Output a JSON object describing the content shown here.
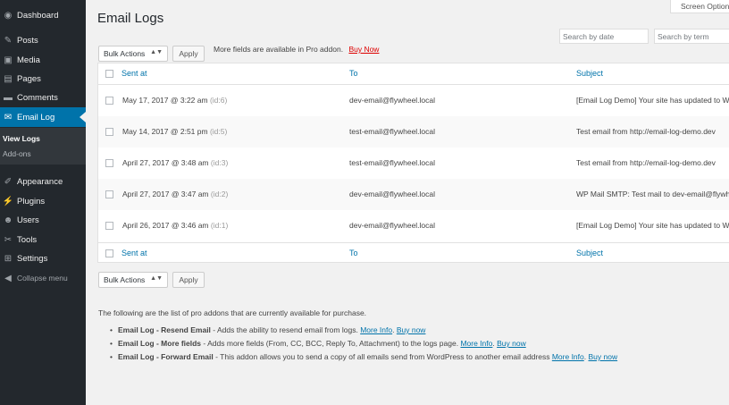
{
  "sidebar": {
    "items": [
      {
        "label": "Dashboard",
        "icon": "dashboard-icon",
        "glyph": "◉"
      },
      {
        "label": "Posts",
        "icon": "pin-icon",
        "glyph": "✎"
      },
      {
        "label": "Media",
        "icon": "media-icon",
        "glyph": "▣"
      },
      {
        "label": "Pages",
        "icon": "pages-icon",
        "glyph": "▤"
      },
      {
        "label": "Comments",
        "icon": "comment-icon",
        "glyph": "▬"
      },
      {
        "label": "Email Log",
        "icon": "email-icon",
        "glyph": "✉"
      },
      {
        "label": "Appearance",
        "icon": "brush-icon",
        "glyph": "✐"
      },
      {
        "label": "Plugins",
        "icon": "plugin-icon",
        "glyph": "⚡"
      },
      {
        "label": "Users",
        "icon": "users-icon",
        "glyph": "☻"
      },
      {
        "label": "Tools",
        "icon": "wrench-icon",
        "glyph": "✂"
      },
      {
        "label": "Settings",
        "icon": "settings-icon",
        "glyph": "⊞"
      }
    ],
    "submenu": [
      "View Logs",
      "Add-ons"
    ],
    "collapse_label": "Collapse menu",
    "collapse_glyph": "◀"
  },
  "header": {
    "title": "Email Logs",
    "screen_options": "Screen Options"
  },
  "search": {
    "by_date_placeholder": "Search by date",
    "by_term_placeholder": "Search by term"
  },
  "bulk": {
    "label": "Bulk Actions",
    "apply": "Apply",
    "caret": "▲▼"
  },
  "pro_note": {
    "text": "More fields are available in Pro addon.",
    "link": "Buy Now"
  },
  "table": {
    "columns": [
      "Sent at",
      "To",
      "Subject"
    ],
    "rows": [
      {
        "sent": "May 17, 2017 @ 3:22 am",
        "id": "(id:6)",
        "to": "dev-email@flywheel.local",
        "subject": "[Email Log Demo] Your site has updated to WordPress"
      },
      {
        "sent": "May 14, 2017 @ 2:51 pm",
        "id": "(id:5)",
        "to": "test-email@flywheel.local",
        "subject": "Test email from http://email-log-demo.dev"
      },
      {
        "sent": "April 27, 2017 @ 3:48 am",
        "id": "(id:3)",
        "to": "test-email@flywheel.local",
        "subject": "Test email from http://email-log-demo.dev"
      },
      {
        "sent": "April 27, 2017 @ 3:47 am",
        "id": "(id:2)",
        "to": "dev-email@flywheel.local",
        "subject": "WP Mail SMTP: Test mail to dev-email@flywheel.local"
      },
      {
        "sent": "April 26, 2017 @ 3:46 am",
        "id": "(id:1)",
        "to": "dev-email@flywheel.local",
        "subject": "[Email Log Demo] Your site has updated to WordPress"
      }
    ]
  },
  "addons": {
    "intro": "The following are the list of pro addons that are currently available for purchase.",
    "bullet": "•",
    "items": [
      {
        "name": "Email Log - Resend Email",
        "desc": " - Adds the ability to resend email from logs.",
        "more": "More Info",
        "sep": ".",
        "buy": "Buy now"
      },
      {
        "name": "Email Log - More fields",
        "desc": " - Adds more fields (From, CC, BCC, Reply To, Attachment) to the logs page.",
        "more": "More Info",
        "sep": ".",
        "buy": "Buy now"
      },
      {
        "name": "Email Log - Forward Email",
        "desc": " - This addon allows you to send a copy of all emails send from WordPress to another email address",
        "more": "More Info",
        "sep": ".",
        "buy": "Buy now"
      }
    ]
  },
  "colors": {
    "sidebar_bg": "#23282d",
    "active_bg": "#0073aa",
    "link": "#0073aa",
    "buy_now": "#dd0000"
  }
}
